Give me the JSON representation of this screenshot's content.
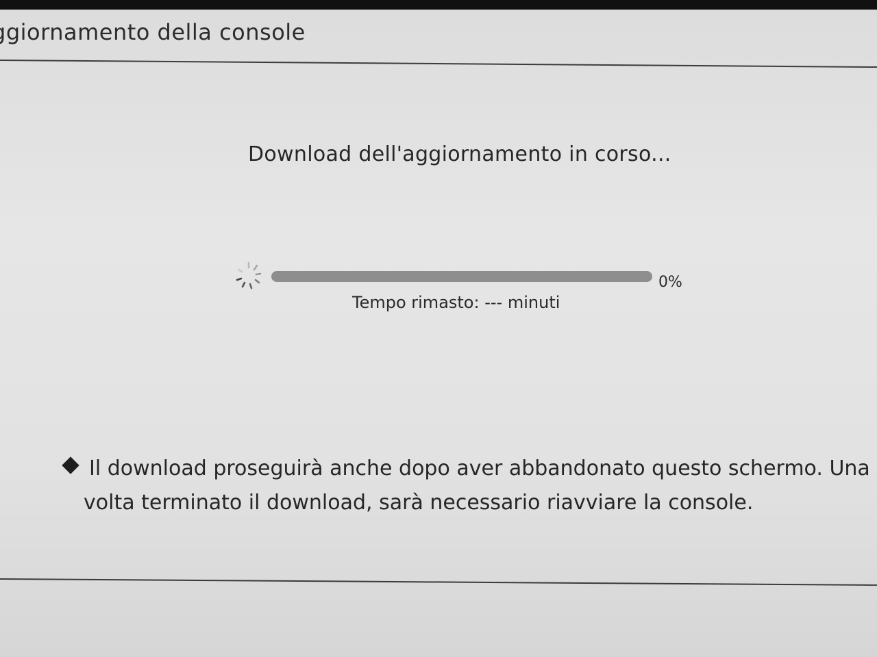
{
  "header": {
    "title": "ggiornamento della console"
  },
  "download": {
    "status": "Download dell'aggiornamento in corso...",
    "progress_percent": 0,
    "progress_label": "0%",
    "time_remaining_label": "Tempo rimasto:",
    "time_remaining_value": "---",
    "time_remaining_unit": "minuti",
    "spinner_icon": "loading-spinner-icon"
  },
  "note": {
    "bullet_icon": "diamond-bullet-icon",
    "line1": "Il download proseguirà anche dopo aver abbandonato questo schermo. Una",
    "line2": "volta terminato il download, sarà necessario riavviare la console."
  },
  "colors": {
    "background": "#e2e2e2",
    "text": "#2a2a2a",
    "progress_track": "#8e8e8e",
    "progress_fill": "#1cc8c8",
    "divider": "#3a3a3a"
  }
}
